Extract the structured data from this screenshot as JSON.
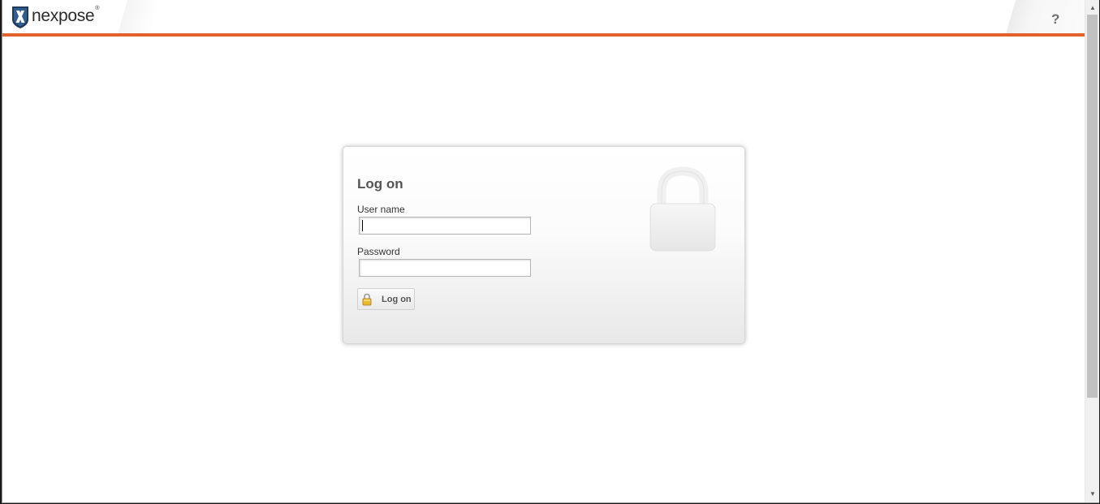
{
  "header": {
    "brand": "nexpose",
    "brand_mark": "®",
    "help_label": "?",
    "accent_color": "#e2612c"
  },
  "login": {
    "title": "Log on",
    "username_label": "User name",
    "username_value": "",
    "password_label": "Password",
    "password_value": "",
    "submit_label": "Log on"
  },
  "icons": {
    "logo": "nexpose-shield-logo",
    "help": "help-icon",
    "button": "padlock-icon",
    "watermark": "padlock-watermark"
  }
}
